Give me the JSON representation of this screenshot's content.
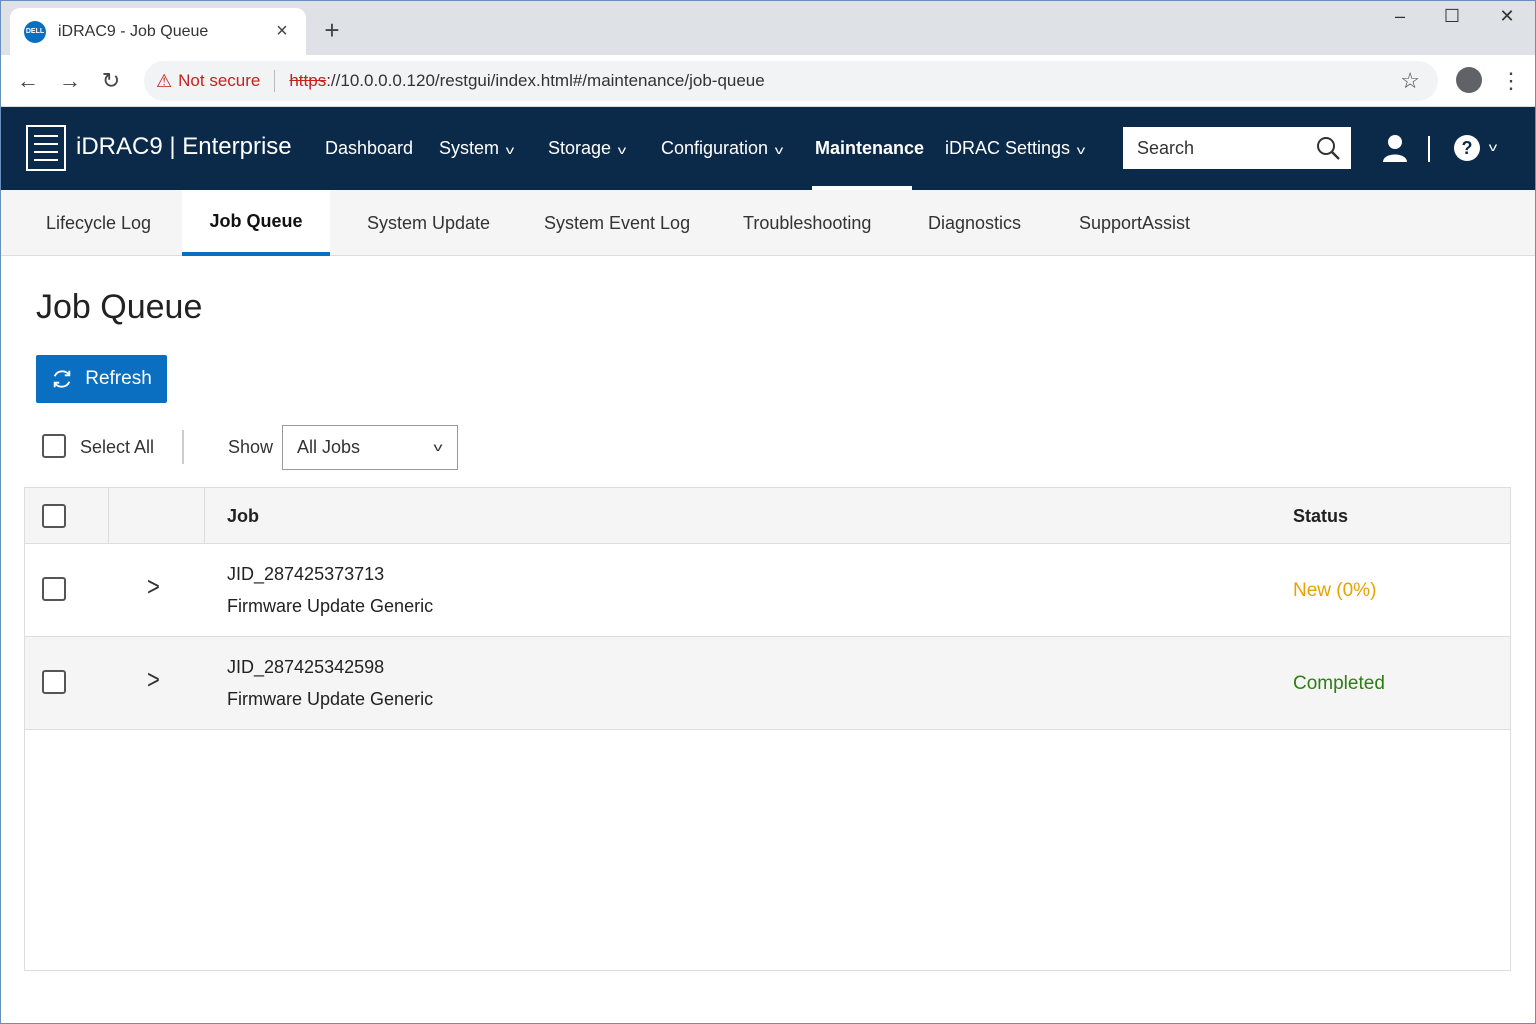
{
  "browser": {
    "tab_title": "iDRAC9 - Job Queue",
    "favicon_text": "DELL",
    "security_label": "Not secure",
    "url_scheme": "https",
    "url_rest": "://10.0.0.0.120/restgui/index.html#/maintenance/job-queue"
  },
  "app": {
    "brand": "iDRAC9 | Enterprise",
    "nav": [
      {
        "label": "Dashboard"
      },
      {
        "label": "System"
      },
      {
        "label": "Storage"
      },
      {
        "label": "Configuration"
      },
      {
        "label": "Maintenance"
      },
      {
        "label": "iDRAC Settings"
      }
    ],
    "active_nav": "Maintenance",
    "search_placeholder": "Search"
  },
  "subtabs": [
    {
      "label": "Lifecycle Log"
    },
    {
      "label": "Job Queue"
    },
    {
      "label": "System Update"
    },
    {
      "label": "System Event Log"
    },
    {
      "label": "Troubleshooting"
    },
    {
      "label": "Diagnostics"
    },
    {
      "label": "SupportAssist"
    }
  ],
  "active_subtab": "Job Queue",
  "page": {
    "title": "Job Queue",
    "refresh_label": "Refresh",
    "select_all_label": "Select All",
    "show_label": "Show",
    "show_value": "All Jobs"
  },
  "table": {
    "columns": [
      "Job",
      "Status"
    ],
    "rows": [
      {
        "jid": "JID_287425373713",
        "name": "Firmware Update Generic",
        "status": "New (0%)",
        "status_color": "#e8a200"
      },
      {
        "jid": "JID_287425342598",
        "name": "Firmware Update Generic",
        "status": "Completed",
        "status_color": "#2e7d15"
      }
    ]
  },
  "colors": {
    "header_bg": "#0b2a4a",
    "accent": "#0b6fc1"
  }
}
